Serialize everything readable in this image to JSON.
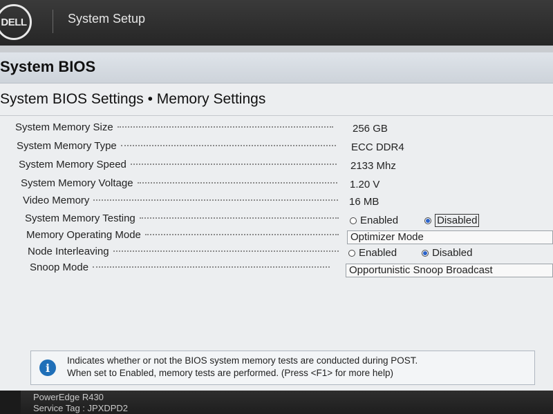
{
  "header": {
    "logo_text": "DELL",
    "app_title": "System Setup"
  },
  "page": {
    "title": "System BIOS",
    "breadcrumb": "System BIOS Settings • Memory Settings"
  },
  "settings": [
    {
      "label": "System Memory Size",
      "value": "256 GB"
    },
    {
      "label": "System Memory Type",
      "value": "ECC DDR4"
    },
    {
      "label": "System Memory Speed",
      "value": "2133 Mhz"
    },
    {
      "label": "System Memory Voltage",
      "value": "1.20 V"
    },
    {
      "label": "Video Memory",
      "value": "16 MB"
    },
    {
      "label": "System Memory Testing",
      "options": [
        "Enabled",
        "Disabled"
      ],
      "selected": "Disabled"
    },
    {
      "label": "Memory Operating Mode",
      "value": "Optimizer Mode"
    },
    {
      "label": "Node Interleaving",
      "options": [
        "Enabled",
        "Disabled"
      ],
      "selected": "Disabled"
    },
    {
      "label": "Snoop Mode",
      "value": "Opportunistic Snoop Broadcast"
    }
  ],
  "help": {
    "line1": "Indicates whether or not the BIOS system memory tests are conducted during POST.",
    "line2": "When set to Enabled, memory tests are performed. (Press <F1> for more help)"
  },
  "footer": {
    "model": "PowerEdge R430",
    "service_tag": "Service Tag : JPXDPD2"
  },
  "colors": {
    "header_bg": "#262626",
    "panel_bg": "#eceef0",
    "radio_selected": "#2a62c9",
    "info_icon": "#1f6fb8"
  }
}
